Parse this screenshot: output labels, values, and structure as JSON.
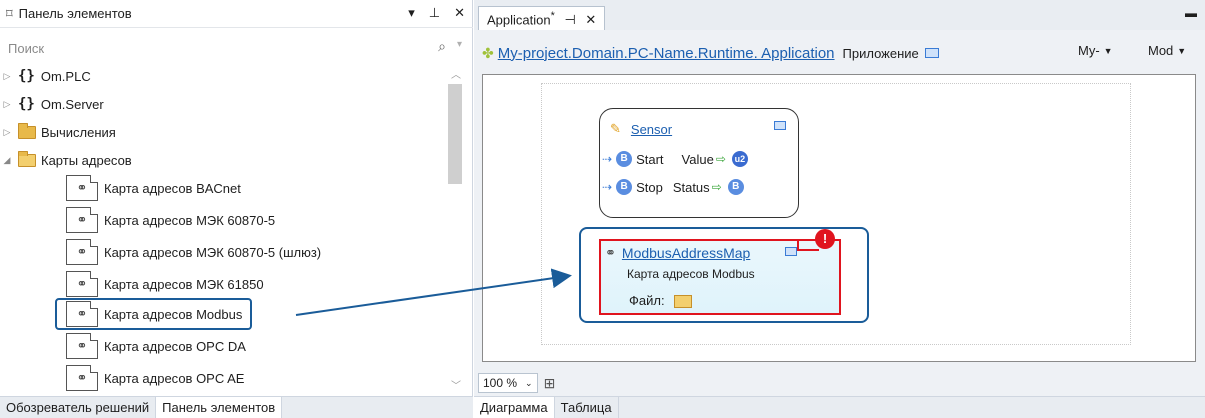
{
  "toolbox": {
    "title": "Панель элементов",
    "header_buttons": [
      "▾",
      "⊥",
      "✕"
    ],
    "search_placeholder": "Поиск",
    "tree": [
      {
        "label": "Om.PLC",
        "kind": "namespace"
      },
      {
        "label": "Om.Server",
        "kind": "namespace"
      },
      {
        "label": "Вычисления",
        "kind": "folder"
      },
      {
        "label": "Карты адресов",
        "kind": "folder-open"
      }
    ],
    "maps": [
      {
        "label": "Карта адресов BACnet"
      },
      {
        "label": "Карта адресов МЭК 60870-5"
      },
      {
        "label": "Карта адресов МЭК 60870-5 (шлюз)"
      },
      {
        "label": "Карта адресов МЭК 61850"
      },
      {
        "label": "Карта адресов Modbus",
        "selected": true
      },
      {
        "label": "Карта адресов OPC DA"
      },
      {
        "label": "Карта адресов OPC AE"
      }
    ],
    "tabs": [
      "Обозреватель решений",
      "Панель элементов"
    ]
  },
  "document": {
    "tab_title": "Application",
    "tab_modified": "*",
    "tab_pin": "⊣",
    "tab_close": "✕",
    "menu_glyph": "▬",
    "app_path": "My-project.Domain.PC-Name.Runtime. Application",
    "app_type": "Приложение",
    "combo1": "My-",
    "combo2": "Mod",
    "sensor": {
      "name": "Sensor",
      "rows": [
        {
          "in": "Start",
          "out": "Value",
          "in_badge": "B",
          "out_badge": "u2"
        },
        {
          "in": "Stop",
          "out": "Status",
          "in_badge": "B",
          "out_badge": "B"
        }
      ]
    },
    "modbus": {
      "name": "ModbusAddressMap",
      "description": "Карта адресов Modbus",
      "file_label": "Файл:",
      "error_glyph": "!"
    },
    "zoom": "100 %",
    "bottom_tabs": [
      "Диаграмма",
      "Таблица"
    ]
  },
  "colors": {
    "accent": "#1a5c99",
    "error": "#e0141e",
    "link": "#1c5fb0"
  }
}
